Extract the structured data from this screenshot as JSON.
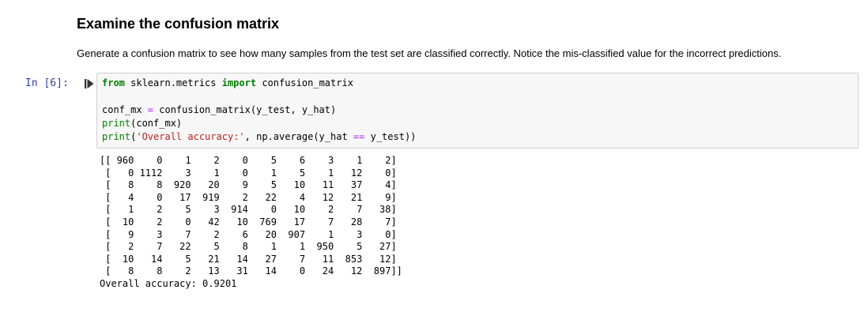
{
  "markdown": {
    "title": "Examine the confusion matrix",
    "description": "Generate a confusion matrix to see how many samples from the test set are classified correctly. Notice the mis-classified value for the incorrect predictions."
  },
  "cell": {
    "prompt": "In [6]:",
    "run_icon": "run-cell-icon",
    "code": {
      "l1_kw": "from",
      "l1_mod": " sklearn.metrics ",
      "l1_kw2": "import",
      "l1_rest": " confusion_matrix",
      "l3_a": "conf_mx ",
      "l3_eq": "=",
      "l3_b": " confusion_matrix(y_test, y_hat)",
      "l4_fn": "print",
      "l4_rest": "(conf_mx)",
      "l5_fn": "print",
      "l5_open": "(",
      "l5_str": "'Overall accuracy:'",
      "l5_mid": ", np.average(y_hat ",
      "l5_op": "==",
      "l5_end": " y_test))"
    }
  },
  "output": {
    "matrix_text": "[[ 960    0    1    2    0    5    6    3    1    2]\n [   0 1112    3    1    0    1    5    1   12    0]\n [   8    8  920   20    9    5   10   11   37    4]\n [   4    0   17  919    2   22    4   12   21    9]\n [   1    2    5    3  914    0   10    2    7   38]\n [  10    2    0   42   10  769   17    7   28    7]\n [   9    3    7    2    6   20  907    1    3    0]\n [   2    7   22    5    8    1    1  950    5   27]\n [  10   14    5   21   14   27    7   11  853   12]\n [   8    8    2   13   31   14    0   24   12  897]]",
    "accuracy_line": "Overall accuracy: 0.9201"
  }
}
